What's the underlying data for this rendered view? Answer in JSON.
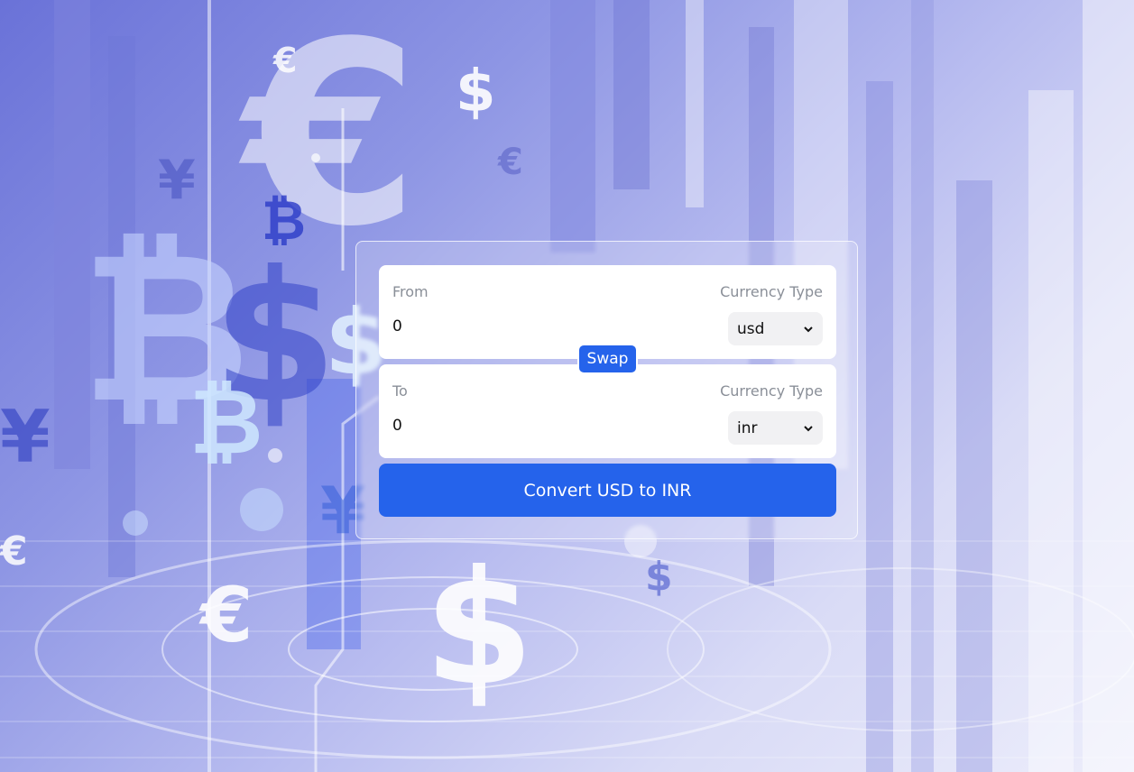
{
  "background": {
    "symbols": [
      "€",
      "$",
      "¥",
      "₿"
    ],
    "accent": "#6a72d8"
  },
  "converter": {
    "from": {
      "label": "From",
      "amount": "0",
      "currency_type_label": "Currency Type",
      "currency": "usd"
    },
    "swap_label": "Swap",
    "to": {
      "label": "To",
      "amount": "0",
      "currency_type_label": "Currency Type",
      "currency": "inr"
    },
    "convert_label": "Convert USD to INR"
  },
  "colors": {
    "primary": "#2563eb",
    "muted_text": "#8a8f98",
    "select_bg": "#f1f1f3"
  }
}
